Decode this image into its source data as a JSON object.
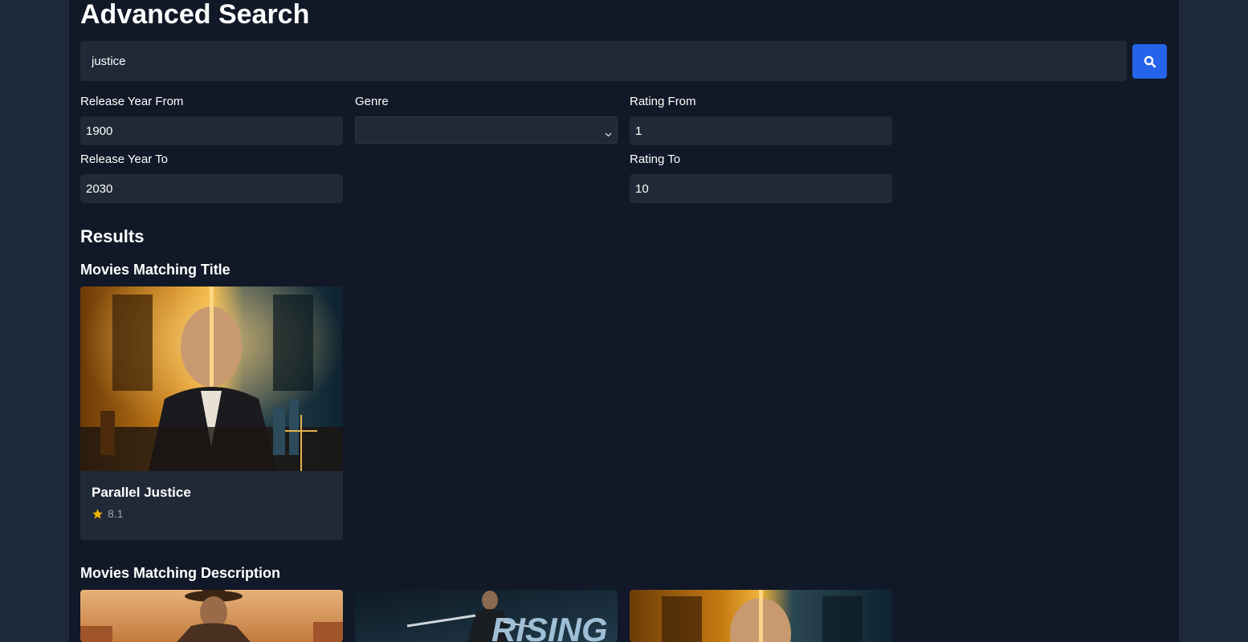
{
  "page": {
    "title": "Advanced Search"
  },
  "search": {
    "value": "justice",
    "icon": "search-icon",
    "button_color": "#2563eb"
  },
  "filters": {
    "year_from": {
      "label": "Release Year From",
      "value": "1900"
    },
    "year_to": {
      "label": "Release Year To",
      "value": "2030"
    },
    "genre": {
      "label": "Genre",
      "value": ""
    },
    "rating_from": {
      "label": "Rating From",
      "value": "1"
    },
    "rating_to": {
      "label": "Rating To",
      "value": "10"
    }
  },
  "results": {
    "heading": "Results",
    "title_matches": {
      "heading": "Movies Matching Title",
      "items": [
        {
          "title": "Parallel Justice",
          "rating": "8.1"
        }
      ]
    },
    "description_matches": {
      "heading": "Movies Matching Description",
      "items": [
        {
          "poster": "western-poster"
        },
        {
          "poster": "action-poster",
          "poster_text": "RISING"
        },
        {
          "poster": "justice-poster"
        }
      ]
    }
  },
  "colors": {
    "star": "#f5b301",
    "accent": "#2563eb",
    "background": "#111827",
    "panel": "#1f2937"
  }
}
